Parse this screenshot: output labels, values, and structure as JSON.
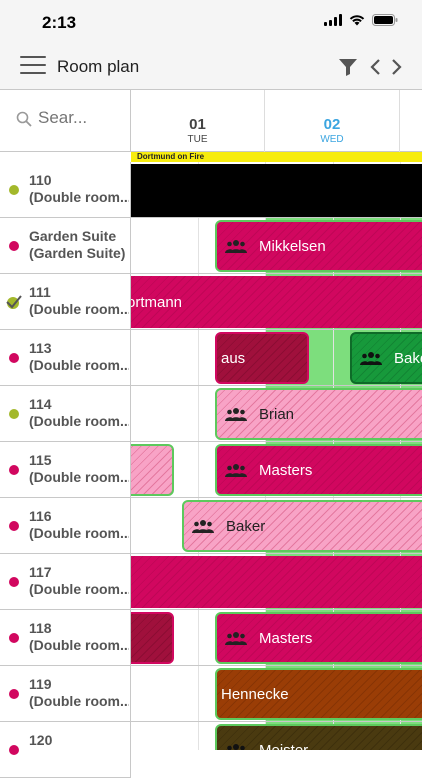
{
  "status": {
    "time": "2:13"
  },
  "appbar": {
    "title": "Room plan"
  },
  "search": {
    "placeholder": "Sear..."
  },
  "dates": [
    {
      "num": "01",
      "dow": "TUE"
    },
    {
      "num": "02",
      "dow": "WED"
    }
  ],
  "event": {
    "label": "Dortmund on Fire"
  },
  "colors": {
    "accent": "#3ba5e0",
    "magenta": "#d1075f",
    "free": "#7dde7d",
    "event": "#f7ec0e"
  },
  "rooms": [
    {
      "name": "110",
      "type": "(Double room...",
      "status": "olive"
    },
    {
      "name": "Garden Suite",
      "type": "(Garden Suite)",
      "status": "red"
    },
    {
      "name": "111",
      "type": "(Double room...",
      "status": "check"
    },
    {
      "name": "113",
      "type": "(Double room...",
      "status": "red"
    },
    {
      "name": "114",
      "type": "(Double room...",
      "status": "olive"
    },
    {
      "name": "115",
      "type": "(Double room...",
      "status": "red"
    },
    {
      "name": "116",
      "type": "(Double room...",
      "status": "red"
    },
    {
      "name": "117",
      "type": "(Double room...",
      "status": "red"
    },
    {
      "name": "118",
      "type": "(Double room...",
      "status": "red"
    },
    {
      "name": "119",
      "type": "(Double room...",
      "status": "red"
    },
    {
      "name": "120",
      "type": "",
      "status": "red"
    }
  ],
  "bookings": {
    "b_garden": {
      "label": "Mikkelsen",
      "group": true
    },
    "b_111": {
      "label": "ortmann",
      "group": false
    },
    "b_113a": {
      "label": "aus",
      "group": false
    },
    "b_113b": {
      "label": "Bake",
      "group": true
    },
    "b_114": {
      "label": "Brian",
      "group": true
    },
    "b_115": {
      "label": "Masters",
      "group": true
    },
    "b_116": {
      "label": "Baker",
      "group": true
    },
    "b_118": {
      "label": "Masters",
      "group": true
    },
    "b_119": {
      "label": "Hennecke",
      "group": false
    },
    "b_120": {
      "label": "Meister",
      "group": true
    }
  }
}
